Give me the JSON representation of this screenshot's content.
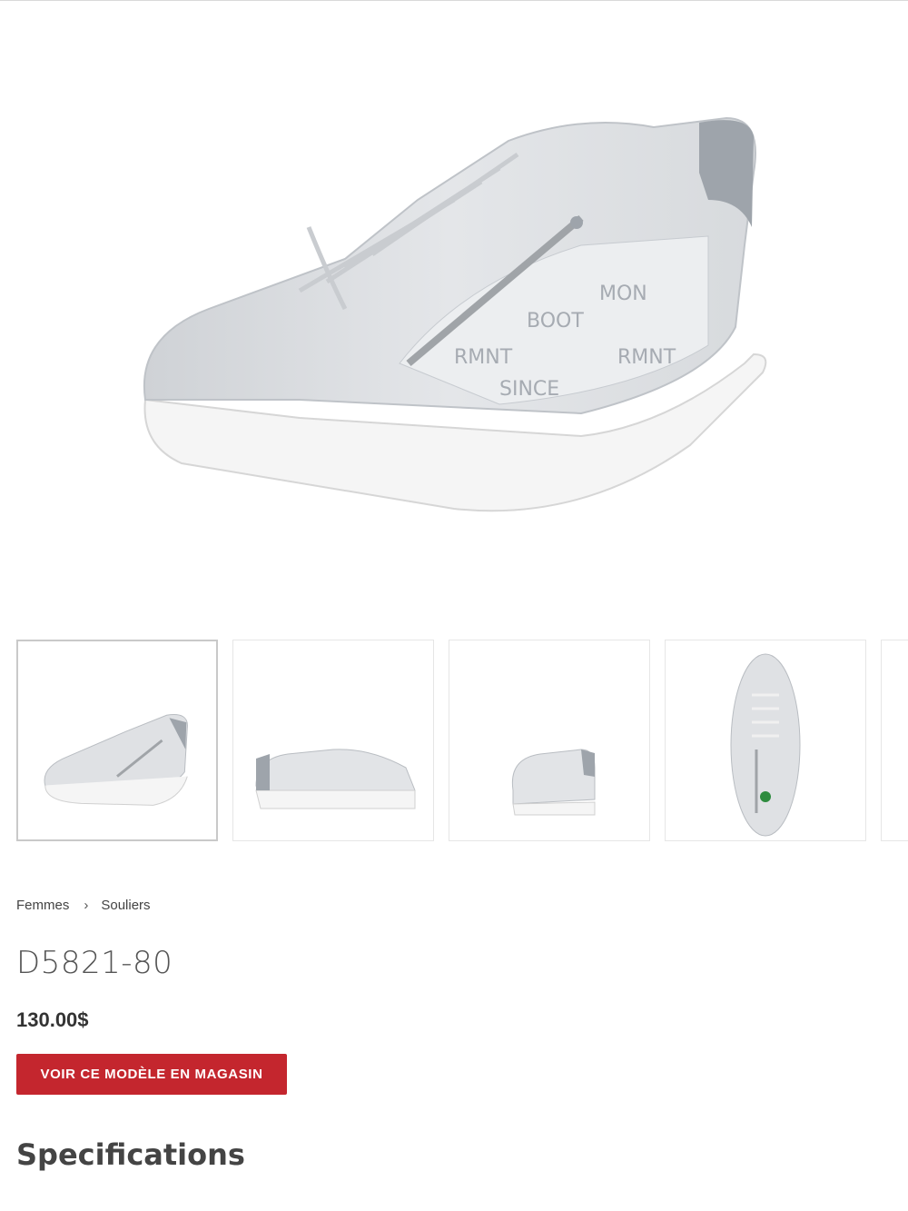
{
  "product": {
    "gallery": {
      "main_image": "shoe-side-angle",
      "thumbnails": [
        "shoe-angle-view",
        "shoe-side-view",
        "shoe-back-view",
        "shoe-top-view",
        "shoe-more-view"
      ],
      "selected_index": 0
    },
    "breadcrumb": {
      "items": [
        "Femmes",
        "Souliers"
      ],
      "separator": "›"
    },
    "title": "D5821-80",
    "price": "130.00$",
    "store_button": "VOIR CE MODÈLE EN MAGASIN",
    "specs_heading": "Specifications"
  },
  "colors": {
    "accent": "#c4262e",
    "shoe_body": "#dcdee2",
    "shoe_silver": "#9ea4ab",
    "sole": "#f7f7f7"
  }
}
